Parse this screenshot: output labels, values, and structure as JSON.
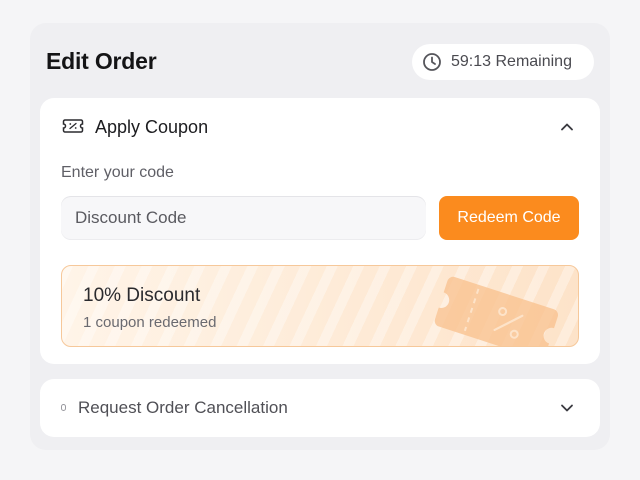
{
  "header": {
    "title": "Edit Order",
    "timer_text": "59:13 Remaining",
    "timer_icon": "clock-icon"
  },
  "coupon": {
    "section_title": "Apply Coupon",
    "section_icon": "ticket-icon",
    "expanded": true,
    "input_label": "Enter your code",
    "input_placeholder": "Discount Code",
    "input_value": "",
    "redeem_label": "Redeem Code",
    "accent_color": "#fb8b1e",
    "applied": {
      "title": "10% Discount",
      "subtitle": "1 coupon redeemed"
    }
  },
  "cancellation": {
    "section_title": "Request Order Cancellation",
    "expanded": false
  }
}
